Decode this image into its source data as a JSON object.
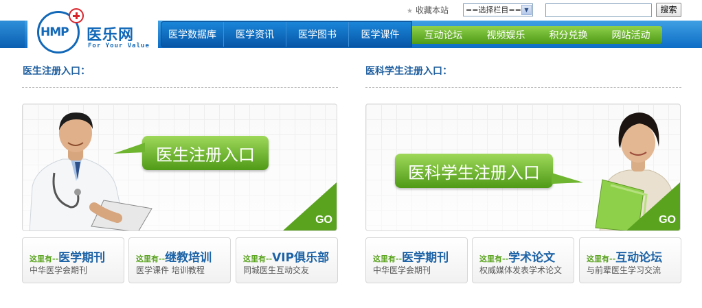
{
  "topbar": {
    "favorite_label": "收藏本站",
    "select_value": "==选择栏目==",
    "search_button": "搜索"
  },
  "logo": {
    "mark_text": "HMP",
    "name_cn": "医乐网",
    "slogan_en": "For Your Value"
  },
  "nav": {
    "blue_items": [
      "医学数据库",
      "医学资讯",
      "医学图书",
      "医学课件"
    ],
    "green_items": [
      "互动论坛",
      "视频娱乐",
      "积分兑换",
      "网站活动"
    ]
  },
  "colors": {
    "brand_blue": "#1268b8",
    "nav_green": "#6cb52f",
    "title_blue": "#1f5f9f"
  },
  "doctor": {
    "section_title": "医生注册入口：",
    "banner_label": "医生注册入口",
    "go_label": "GO",
    "cards": [
      {
        "prefix": "这里有--",
        "title": "医学期刊",
        "subtitle": "中华医学会期刊"
      },
      {
        "prefix": "这里有--",
        "title": "继教培训",
        "subtitle": "医学课件 培训教程"
      },
      {
        "prefix": "这里有--",
        "title": "VIP俱乐部",
        "subtitle": "同城医生互动交友"
      }
    ]
  },
  "student": {
    "section_title": "医科学生注册入口：",
    "banner_label": "医科学生注册入口",
    "go_label": "GO",
    "cards": [
      {
        "prefix": "这里有--",
        "title": "医学期刊",
        "subtitle": "中华医学会期刊"
      },
      {
        "prefix": "这里有--",
        "title": "学术论文",
        "subtitle": "权威媒体发表学术论文"
      },
      {
        "prefix": "这里有--",
        "title": "互动论坛",
        "subtitle": "与前辈医生学习交流"
      }
    ]
  }
}
